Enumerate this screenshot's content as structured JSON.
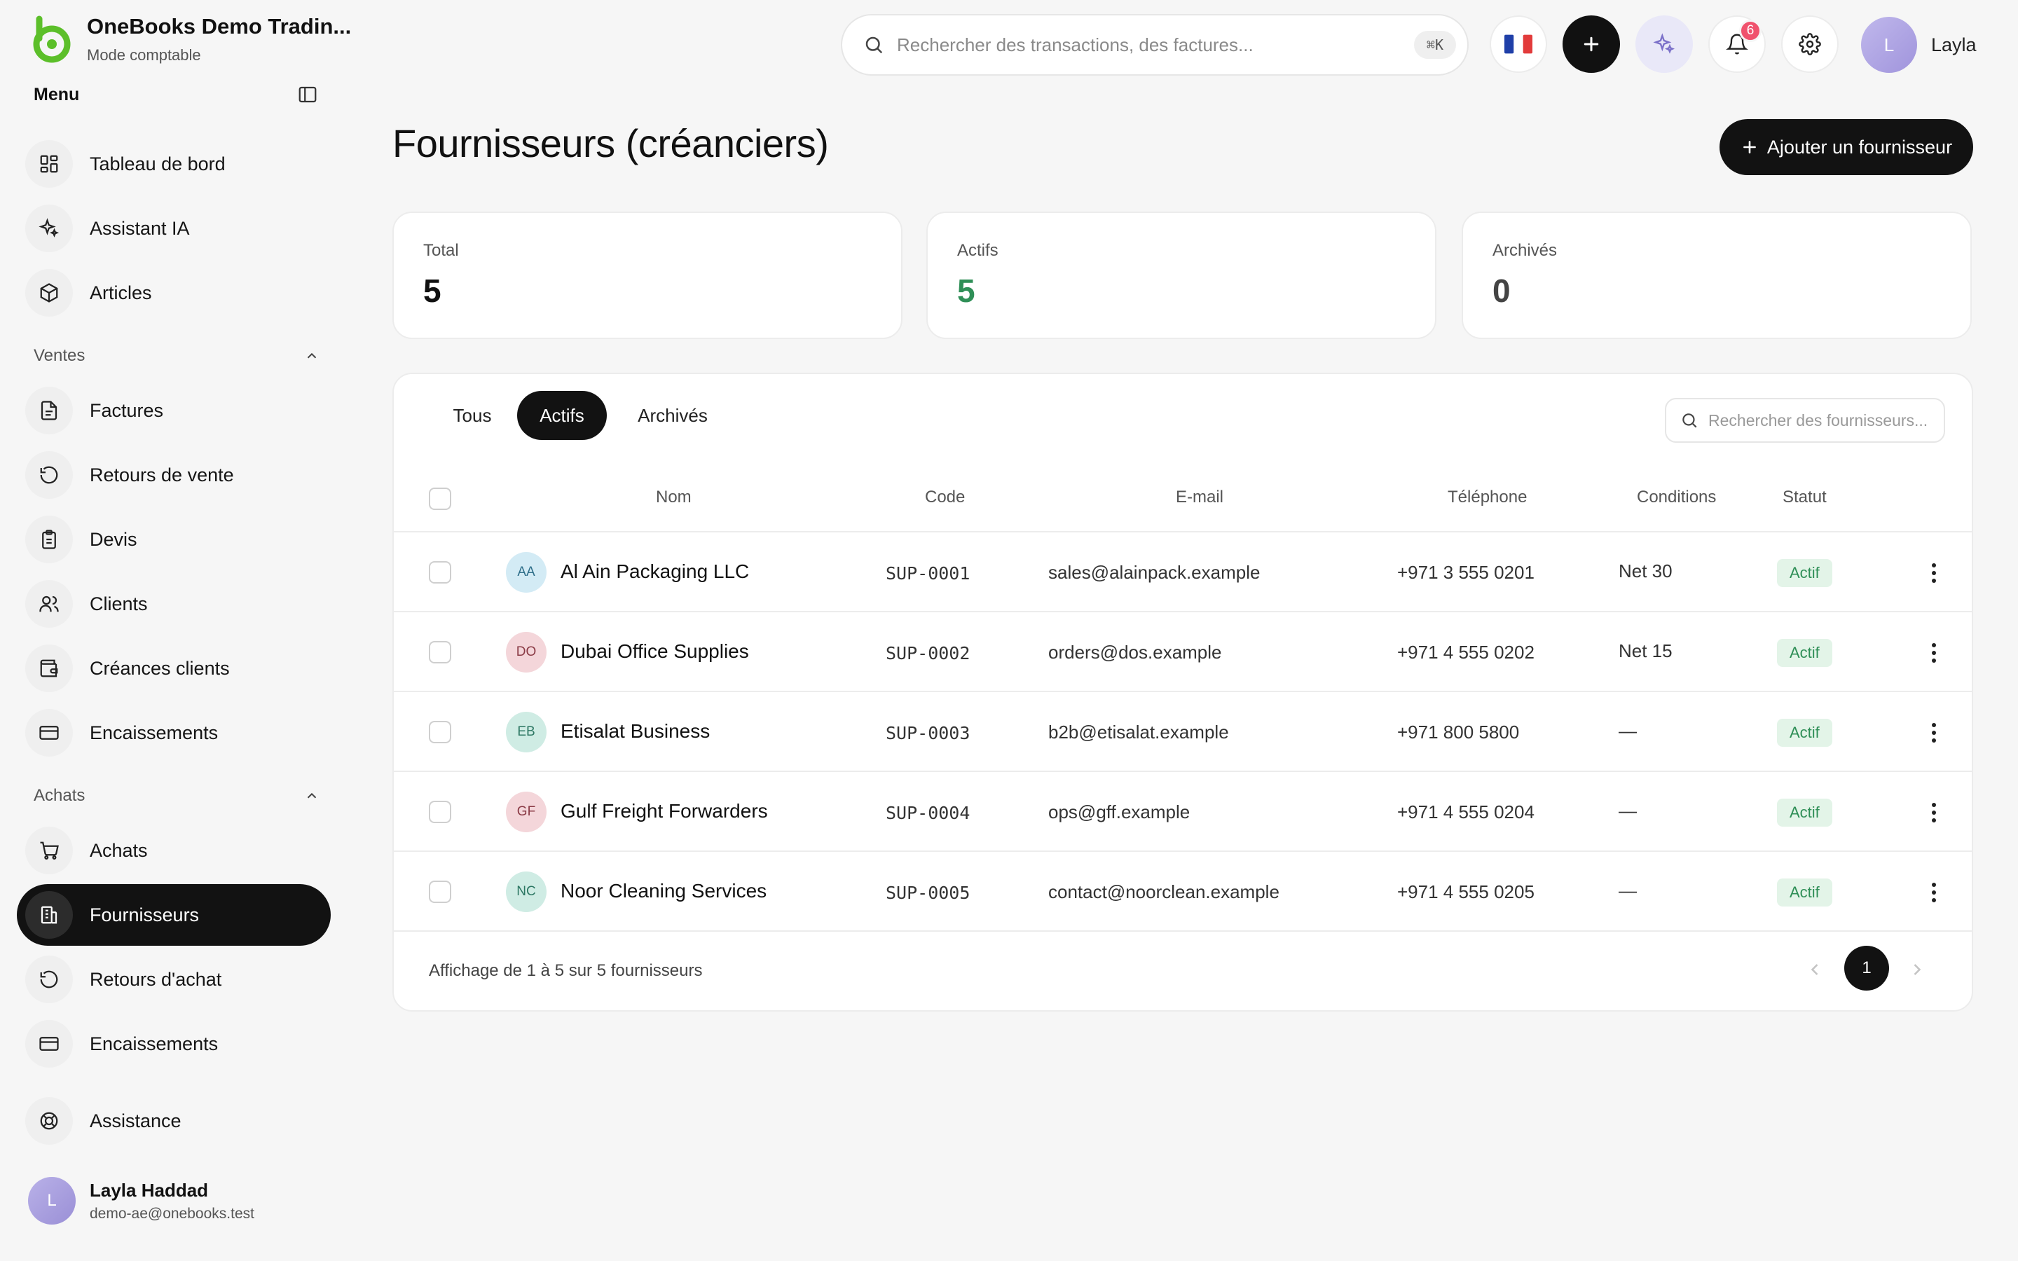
{
  "brand": {
    "name": "OneBooks Demo Tradin...",
    "mode": "Mode comptable",
    "accent": "#5cbf2a"
  },
  "sidebar": {
    "menu_title": "Menu",
    "items_top": [
      {
        "label": "Tableau de bord",
        "icon": "dashboard-icon"
      },
      {
        "label": "Assistant IA",
        "icon": "sparkles-icon"
      },
      {
        "label": "Articles",
        "icon": "package-icon"
      }
    ],
    "sales_section": "Ventes",
    "sales_items": [
      {
        "label": "Factures",
        "icon": "invoice-icon"
      },
      {
        "label": "Retours de vente",
        "icon": "undo-icon"
      },
      {
        "label": "Devis",
        "icon": "quote-icon"
      },
      {
        "label": "Clients",
        "icon": "users-icon"
      },
      {
        "label": "Créances clients",
        "icon": "wallet-icon"
      },
      {
        "label": "Encaissements",
        "icon": "card-icon"
      }
    ],
    "purchases_section": "Achats",
    "purchase_items": [
      {
        "label": "Achats",
        "icon": "cart-icon"
      },
      {
        "label": "Fournisseurs",
        "icon": "building-icon",
        "active": true
      },
      {
        "label": "Retours d'achat",
        "icon": "undo-icon"
      },
      {
        "label": "Encaissements",
        "icon": "card-icon"
      }
    ],
    "help_item": "Assistance",
    "user": {
      "initial": "L",
      "name": "Layla Haddad",
      "email": "demo-ae@onebooks.test"
    }
  },
  "topbar": {
    "search_placeholder": "Rechercher des transactions, des factures...",
    "shortcut": "⌘K",
    "notifications_count": "6",
    "user_initial": "L",
    "user_name": "Layla"
  },
  "page": {
    "title": "Fournisseurs (créanciers)",
    "add_button": "Ajouter un fournisseur"
  },
  "stats": [
    {
      "label": "Total",
      "value": "5"
    },
    {
      "label": "Actifs",
      "value": "5",
      "color": "#2f8f57"
    },
    {
      "label": "Archivés",
      "value": "0"
    }
  ],
  "tabs": [
    {
      "label": "Tous"
    },
    {
      "label": "Actifs",
      "active": true
    },
    {
      "label": "Archivés"
    }
  ],
  "supplier_search_placeholder": "Rechercher des fournisseurs...",
  "table": {
    "headers": {
      "name": "Nom",
      "code": "Code",
      "email": "E-mail",
      "phone": "Téléphone",
      "terms": "Conditions",
      "status": "Statut"
    },
    "rows": [
      {
        "initials": "AA",
        "avatar_bg": "#d3ebf5",
        "avatar_fg": "#2f6f8a",
        "name": "Al Ain Packaging LLC",
        "code": "SUP-0001",
        "email": "sales@alainpack.example",
        "phone": "+971 3 555 0201",
        "terms": "Net 30",
        "status": "Actif"
      },
      {
        "initials": "DO",
        "avatar_bg": "#f4d6da",
        "avatar_fg": "#8a3a45",
        "name": "Dubai Office Supplies",
        "code": "SUP-0002",
        "email": "orders@dos.example",
        "phone": "+971 4 555 0202",
        "terms": "Net 15",
        "status": "Actif"
      },
      {
        "initials": "EB",
        "avatar_bg": "#cfece4",
        "avatar_fg": "#2c7763",
        "name": "Etisalat Business",
        "code": "SUP-0003",
        "email": "b2b@etisalat.example",
        "phone": "+971 800 5800",
        "terms": "—",
        "status": "Actif"
      },
      {
        "initials": "GF",
        "avatar_bg": "#f4d6da",
        "avatar_fg": "#8a3a45",
        "name": "Gulf Freight Forwarders",
        "code": "SUP-0004",
        "email": "ops@gff.example",
        "phone": "+971 4 555 0204",
        "terms": "—",
        "status": "Actif"
      },
      {
        "initials": "NC",
        "avatar_bg": "#cfece4",
        "avatar_fg": "#2c7763",
        "name": "Noor Cleaning Services",
        "code": "SUP-0005",
        "email": "contact@noorclean.example",
        "phone": "+971 4 555 0205",
        "terms": "—",
        "status": "Actif"
      }
    ]
  },
  "footer": {
    "summary": "Affichage de 1 à 5 sur 5 fournisseurs",
    "page": "1"
  }
}
